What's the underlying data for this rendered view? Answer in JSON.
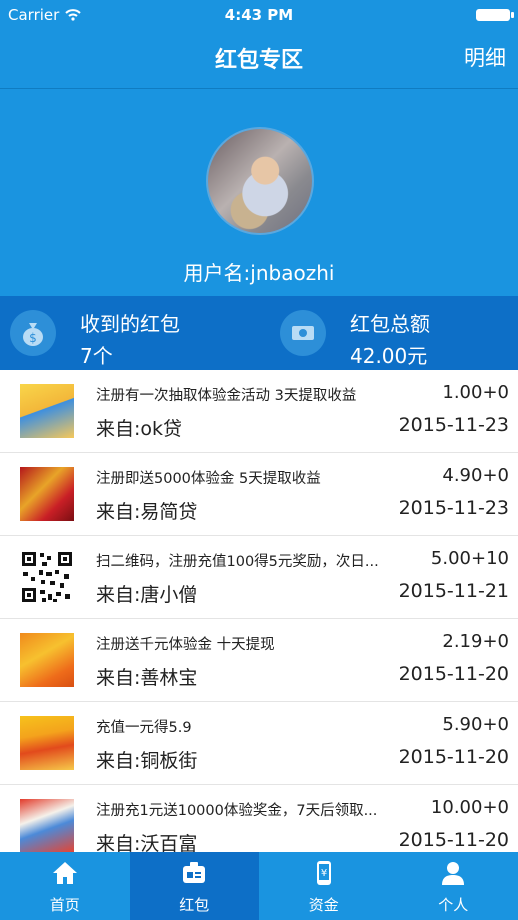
{
  "status_bar": {
    "carrier": "Carrier",
    "time": "4:43 PM"
  },
  "nav": {
    "title": "红包专区",
    "detail": "明细"
  },
  "profile": {
    "username": "用户名:jnbaozhi"
  },
  "stats": {
    "received_label": "收到的红包",
    "received_value": "7个",
    "total_label": "红包总额",
    "total_value": "42.00元"
  },
  "items": [
    {
      "title": "注册有一次抽取体验金活动 3天提取收益",
      "amount": "1.00+0",
      "from": "来自:ok贷",
      "date": "2015-11-23"
    },
    {
      "title": "注册即送5000体验金 5天提取收益",
      "amount": "4.90+0",
      "from": "来自:易简贷",
      "date": "2015-11-23"
    },
    {
      "title": "扫二维码，注册充值100得5元奖励，次日...",
      "amount": "5.00+10",
      "from": "来自:唐小僧",
      "date": "2015-11-21"
    },
    {
      "title": "注册送千元体验金 十天提现",
      "amount": "2.19+0",
      "from": "来自:善林宝",
      "date": "2015-11-20"
    },
    {
      "title": "充值一元得5.9",
      "amount": "5.90+0",
      "from": "来自:铜板街",
      "date": "2015-11-20"
    },
    {
      "title": "注册充1元送10000体验奖金，7天后领取...",
      "amount": "10.00+0",
      "from": "来自:沃百富",
      "date": "2015-11-20"
    }
  ],
  "tabs": [
    {
      "label": "首页"
    },
    {
      "label": "红包"
    },
    {
      "label": "资金"
    },
    {
      "label": "个人"
    }
  ],
  "colors": {
    "primary": "#1a94e0",
    "primary_dark": "#0d6fc7"
  }
}
